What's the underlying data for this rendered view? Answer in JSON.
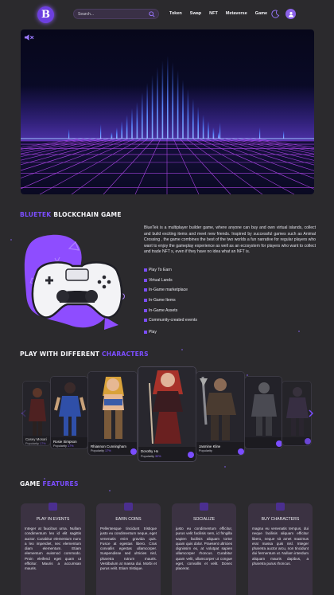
{
  "header": {
    "logo_letter": "B",
    "search_placeholder": "Search...",
    "nav": [
      "Token",
      "Swap",
      "NFT",
      "Metaverse",
      "Game"
    ]
  },
  "colors": {
    "accent": "#7b4dff",
    "background": "#2b2a2d"
  },
  "about": {
    "title_accent": "BLUETEK",
    "title_rest": " BLOCKCHAIN GAME",
    "body": "BlueTek is a multiplayer builder game, where anyone can buy and own virtual islands, collect and build exciting items and meet new friends. Inspired by successful games such as Animal Crossing , the game combines the best of the two worlds a fun narrative for regular players who want to enjoy the gameplay experience as well as an ecosystem for players who want to collect and trade NFT s, even if they have no idea what an NFT is.",
    "features": [
      "Play To Earn",
      "Virtual Lands",
      "In-Game marketplace",
      "In-Game Items",
      "In-Game Assets",
      "Community-created events"
    ],
    "play_label": "Play"
  },
  "characters": {
    "title_main": "PLAY WITH DIFFERENT ",
    "title_accent": "CHARACTERS",
    "cards": [
      {
        "name": "Casey Mosari",
        "pop_label": "Popularity",
        "pop_value": "17%"
      },
      {
        "name": "Rosie Simpson",
        "pop_label": "Popularity",
        "pop_value": "17%"
      },
      {
        "name": "Rhiannon Cunningham",
        "pop_label": "Popularity",
        "pop_value": "17%"
      },
      {
        "name": "Dorothy Ho",
        "pop_label": "Popularity",
        "pop_value": "30%"
      },
      {
        "name": "Jasmine Kline",
        "pop_label": "Popularity",
        "pop_value": ""
      },
      {
        "name": "",
        "pop_label": "",
        "pop_value": ""
      },
      {
        "name": "",
        "pop_label": "",
        "pop_value": ""
      }
    ]
  },
  "game_features": {
    "title_main": "GAME ",
    "title_accent": "FEATURES",
    "cards": [
      {
        "icon": "ticket-icon",
        "title": "PLAY IN EVENTS",
        "text": "Integer at faucibus urna. Nullam condimentum leo id elit sagittis auctor. Curabitur elementum nunc a leo imperdiet, nec elementum diam elementum. Etiam elementum euismod commodo. Proin eleifend eget quam ut efficitur. Mauris a accumsan mauris."
      },
      {
        "icon": "coins-icon",
        "title": "EARN COINS",
        "text": "Pellentesque tincidunt tristique justo eu condimentum neque, eget venenatis enim gravida quis. Fusce at egestas libero. Cras convallis egestas ullamcorper. Suspendisse sed ultricies nisl, pharetra rutrum mauris. Vestibulum at massa dui. Morbi et purus velit. Etiam tristique."
      },
      {
        "icon": "chat-icon",
        "title": "SOCIALIZE",
        "text": "justo eu condimentum efficitur, purus velit facilisis sem, id fringilla sapien facilisis aliquam tortor quam quis dolor. Praesent ultricies dignissim ex, at volutpat sapien ullamcorper rhoncus. Curabitur quam velit, ullamcorper ut congue eget, convallis et velit. Donec placerat."
      },
      {
        "icon": "cart-icon",
        "title": "BUY CHARACTERS",
        "text": "magna eu venenatis tempus, dui neque facilisis aliquam efficitur libero, neque sit amet maximus erat massa quis nisl. Integer pharetra auctor arcu, non tincidunt dui fermentum ut. Nullam interdum aliquam mauris dapibus, a pharetra purus rhoncus."
      }
    ]
  }
}
